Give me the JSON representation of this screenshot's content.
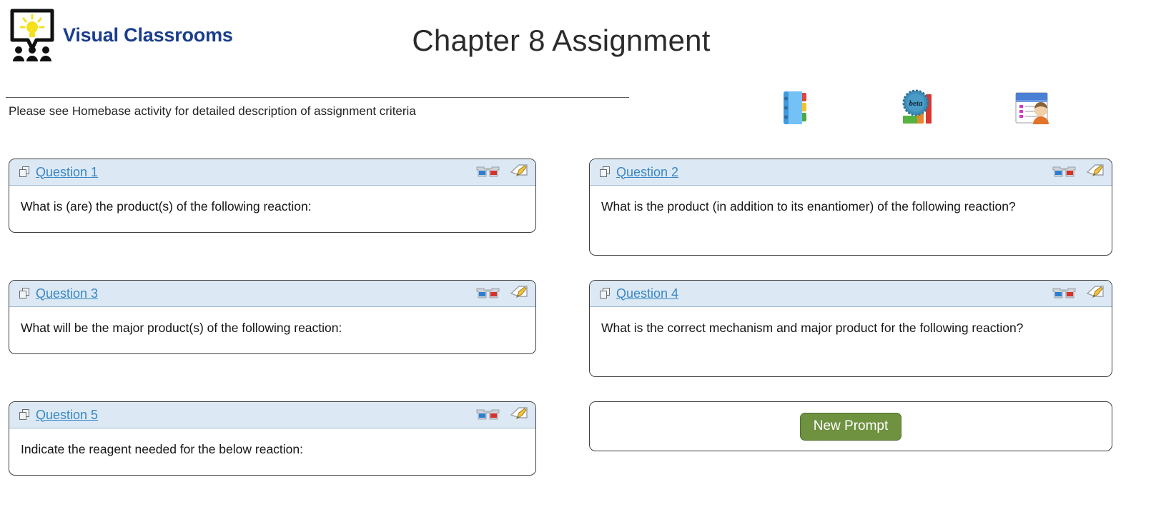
{
  "brand": {
    "name": "Visual Classrooms",
    "logo_icon": "lightbulb-classroom-logo"
  },
  "header": {
    "title": "Chapter 8 Assignment"
  },
  "subtitle": "Please see Homebase activity for detailed description of assignment criteria",
  "toolbar": {
    "items": [
      {
        "icon": "notebook-tabs-icon",
        "name": "notebook"
      },
      {
        "icon": "beta-chart-badge-icon",
        "name": "beta-analytics"
      },
      {
        "icon": "roster-person-icon",
        "name": "roster"
      }
    ]
  },
  "card_icons": {
    "copy": "copy-icon",
    "glasses": "3d-glasses-icon",
    "pencil": "pencil-edit-icon"
  },
  "questions": [
    {
      "label": "Question 1",
      "text": "What is (are) the product(s) of the following reaction:"
    },
    {
      "label": "Question 2",
      "text": "What is the product (in addition to its enantiomer) of the following reaction?"
    },
    {
      "label": "Question 3",
      "text": "What will be the major product(s) of the following reaction:"
    },
    {
      "label": "Question 4",
      "text": "What is the correct mechanism and major product for the following reaction?"
    },
    {
      "label": "Question 5",
      "text": "Indicate the reagent needed for the below reaction:"
    }
  ],
  "prompt_panel": {
    "button_label": "New Prompt"
  },
  "colors": {
    "brand_blue": "#1a3e8c",
    "link_blue": "#3b87c4",
    "card_header": "#dce9f5",
    "button_green": "#6f9240"
  }
}
